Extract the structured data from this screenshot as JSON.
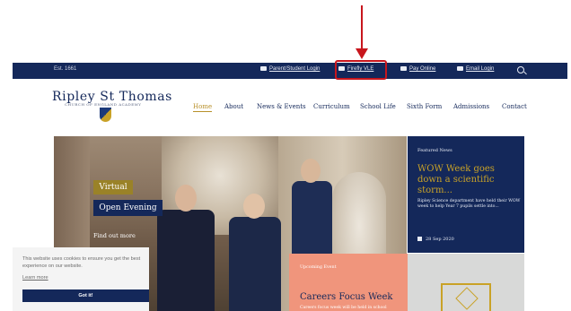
{
  "topbar": {
    "est": "Est. 1661",
    "links": [
      {
        "label": "Parent/Student Login",
        "icon": "users-icon"
      },
      {
        "label": "Firefly VLE",
        "icon": "book-icon"
      },
      {
        "label": "Pay Online",
        "icon": "card-icon"
      },
      {
        "label": "Email Login",
        "icon": "mail-icon"
      }
    ]
  },
  "logo": {
    "title": "Ripley St Thomas",
    "subtitle": "CHURCH OF ENGLAND ACADEMY"
  },
  "nav": [
    "Home",
    "About",
    "News & Events",
    "Curriculum",
    "School Life",
    "Sixth Form",
    "Admissions",
    "Contact"
  ],
  "hero": {
    "tag": "Virtual",
    "heading": "Open Evening",
    "cta": "Find out more"
  },
  "featured": {
    "label": "Featured News",
    "title": "WOW Week goes down a scientific storm...",
    "body": "Ripley Science department have held their WOW week to help Year 7 pupils settle into...",
    "date": "28 Sep 2020"
  },
  "upcoming": {
    "label": "Upcoming Event",
    "title": "Careers Focus Week",
    "body": "Careers focus week will be held in school"
  },
  "cookie": {
    "text": "This website uses cookies to ensure you get the best experience on our website.",
    "learn_more": "Learn more",
    "button": "Got it!"
  },
  "colors": {
    "navy": "#14285a",
    "gold": "#c9a227",
    "salmon": "#f0957c",
    "annotation_red": "#c8161d"
  }
}
